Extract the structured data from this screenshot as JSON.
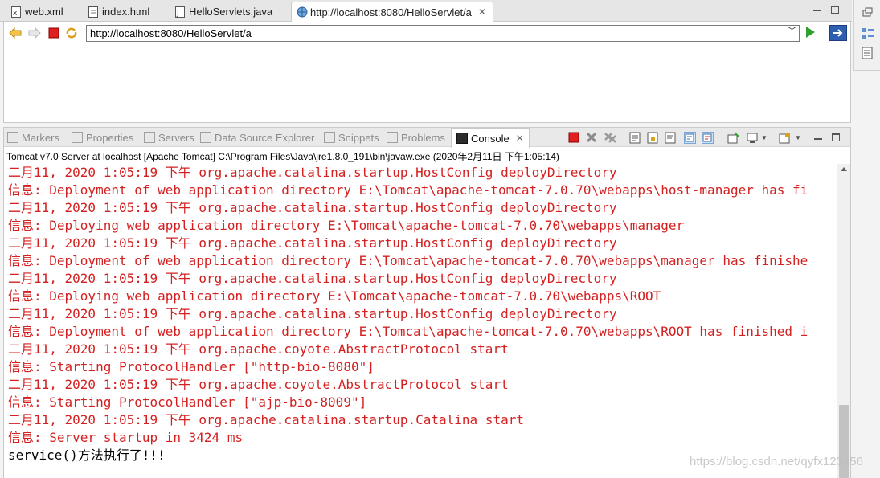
{
  "editor_tabs": [
    {
      "label": "web.xml",
      "icon": "xml-file-icon"
    },
    {
      "label": "index.html",
      "icon": "html-file-icon"
    },
    {
      "label": "HelloServlets.java",
      "icon": "java-file-icon"
    },
    {
      "label": "http://localhost:8080/HelloServlet/a",
      "icon": "globe-icon",
      "active": true
    }
  ],
  "browser": {
    "url": "http://localhost:8080/HelloServlet/a"
  },
  "view_tabs": [
    {
      "label": "Markers"
    },
    {
      "label": "Properties"
    },
    {
      "label": "Servers"
    },
    {
      "label": "Data Source Explorer"
    },
    {
      "label": "Snippets"
    },
    {
      "label": "Problems"
    },
    {
      "label": "Console",
      "active": true
    }
  ],
  "console": {
    "label": "Tomcat v7.0 Server at localhost [Apache Tomcat] C:\\Program Files\\Java\\jre1.8.0_191\\bin\\javaw.exe (2020年2月11日 下午1:05:14)",
    "lines": [
      {
        "text": "二月11, 2020 1:05:19 下午 org.apache.catalina.startup.HostConfig deployDirectory",
        "color": "red"
      },
      {
        "text": "信息: Deployment of web application directory E:\\Tomcat\\apache-tomcat-7.0.70\\webapps\\host-manager has fi",
        "color": "red"
      },
      {
        "text": "二月11, 2020 1:05:19 下午 org.apache.catalina.startup.HostConfig deployDirectory",
        "color": "red"
      },
      {
        "text": "信息: Deploying web application directory E:\\Tomcat\\apache-tomcat-7.0.70\\webapps\\manager",
        "color": "red"
      },
      {
        "text": "二月11, 2020 1:05:19 下午 org.apache.catalina.startup.HostConfig deployDirectory",
        "color": "red"
      },
      {
        "text": "信息: Deployment of web application directory E:\\Tomcat\\apache-tomcat-7.0.70\\webapps\\manager has finishe",
        "color": "red"
      },
      {
        "text": "二月11, 2020 1:05:19 下午 org.apache.catalina.startup.HostConfig deployDirectory",
        "color": "red"
      },
      {
        "text": "信息: Deploying web application directory E:\\Tomcat\\apache-tomcat-7.0.70\\webapps\\ROOT",
        "color": "red"
      },
      {
        "text": "二月11, 2020 1:05:19 下午 org.apache.catalina.startup.HostConfig deployDirectory",
        "color": "red"
      },
      {
        "text": "信息: Deployment of web application directory E:\\Tomcat\\apache-tomcat-7.0.70\\webapps\\ROOT has finished i",
        "color": "red"
      },
      {
        "text": "二月11, 2020 1:05:19 下午 org.apache.coyote.AbstractProtocol start",
        "color": "red"
      },
      {
        "text": "信息: Starting ProtocolHandler [\"http-bio-8080\"]",
        "color": "red"
      },
      {
        "text": "二月11, 2020 1:05:19 下午 org.apache.coyote.AbstractProtocol start",
        "color": "red"
      },
      {
        "text": "信息: Starting ProtocolHandler [\"ajp-bio-8009\"]",
        "color": "red"
      },
      {
        "text": "二月11, 2020 1:05:19 下午 org.apache.catalina.startup.Catalina start",
        "color": "red"
      },
      {
        "text": "信息: Server startup in 3424 ms",
        "color": "red"
      },
      {
        "text": "service()方法执行了!!!",
        "color": "black"
      }
    ]
  },
  "watermark": "https://blog.csdn.net/qyfx123456",
  "colors": {
    "console_error": "#d42020",
    "console_plain": "#000000"
  }
}
